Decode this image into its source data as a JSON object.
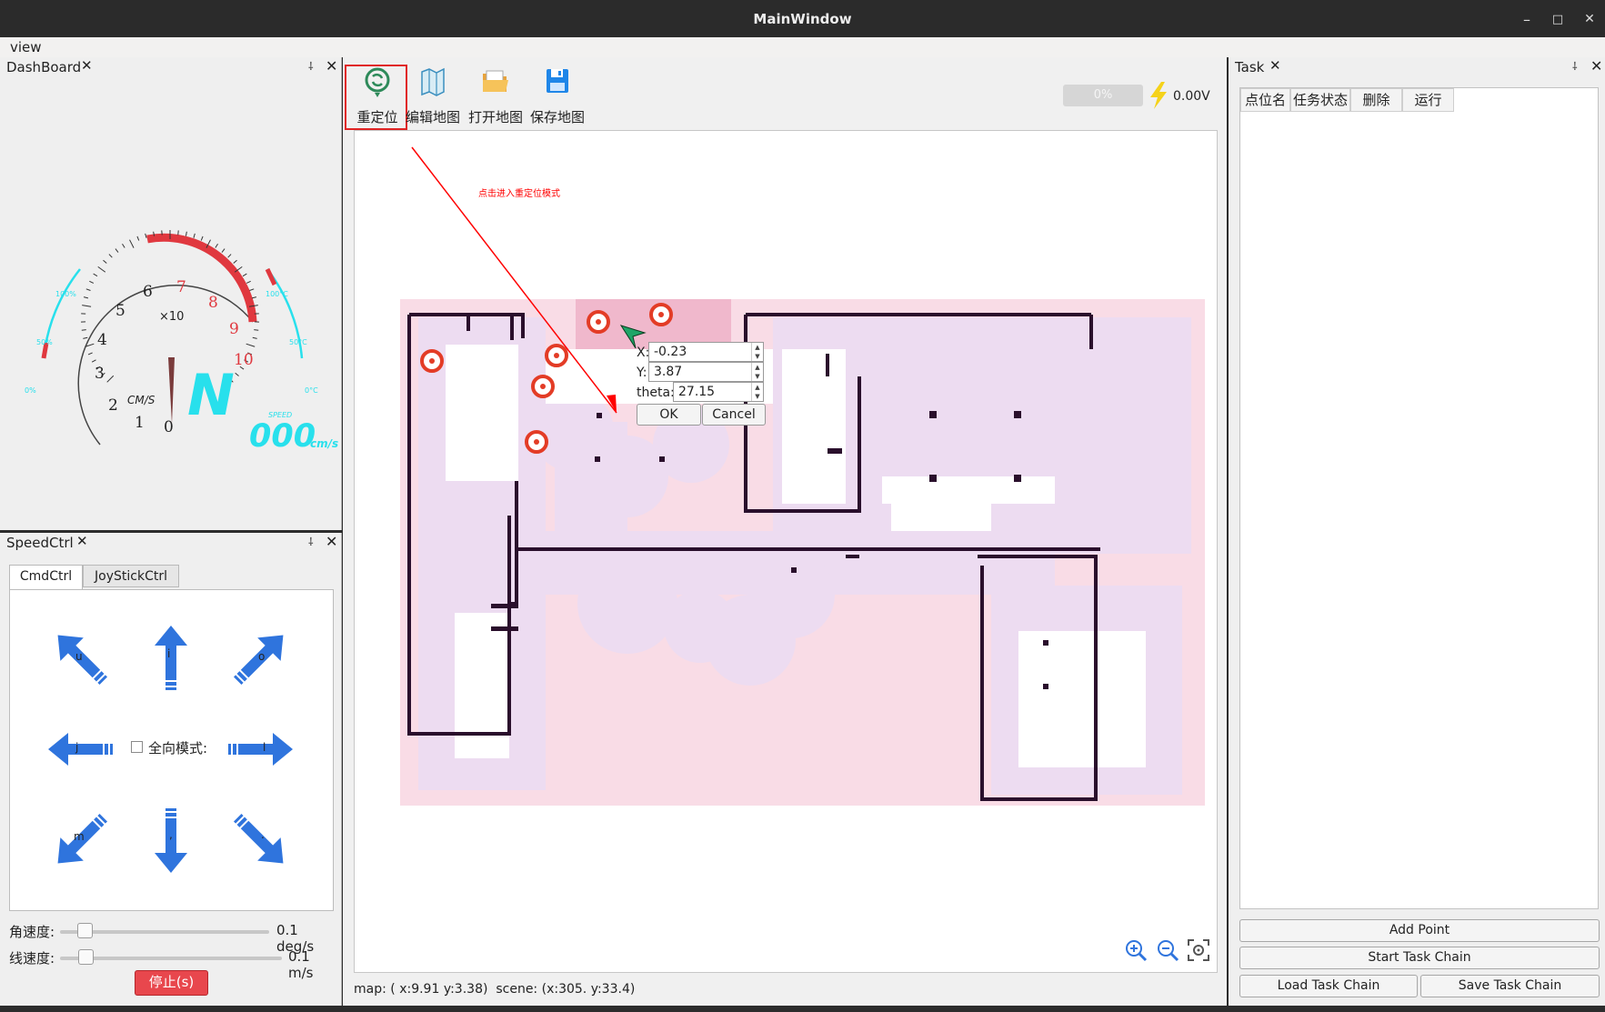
{
  "window": {
    "title": "MainWindow",
    "min": "–",
    "max": "□",
    "close": "✕"
  },
  "menubar": {
    "view": "view"
  },
  "dashboard": {
    "title": "DashBoard",
    "close": "✕",
    "gauge": {
      "ticks": [
        "0",
        "1",
        "2",
        "3",
        "4",
        "5",
        "6",
        "7",
        "8",
        "9",
        "10"
      ],
      "multiplier": "×10",
      "unit": "CM/S",
      "gear": "N",
      "speed_caption": "SPEED",
      "speed_value": "000",
      "speed_unit": "cm/s",
      "left_arc": [
        "100%",
        "50%",
        "0%"
      ],
      "right_arc": [
        "100°C",
        "50°C",
        "0°C"
      ]
    }
  },
  "speedctrl": {
    "title": "SpeedCtrl",
    "close": "✕",
    "tabs": [
      "CmdCtrl",
      "JoyStickCtrl"
    ],
    "keys": {
      "u": "u",
      "i": "i",
      "o": "o",
      "j": "j",
      "l": "l",
      "m": "m",
      "comma": ",",
      "dot": "."
    },
    "omni_label": "全向模式:",
    "angular": {
      "label": "角速度:",
      "value": "0.1 deg/s",
      "level": 0.1
    },
    "linear": {
      "label": "线速度:",
      "value": "0.1 m/s",
      "level": 0.1
    },
    "stop_label": "停止(s)"
  },
  "toolbar": {
    "relocate": "重定位",
    "edit_map": "编辑地图",
    "open_map": "打开地图",
    "save_map": "保存地图",
    "battery_percent": "0%",
    "battery_voltage": "0.00V"
  },
  "map": {
    "annotation": "点击进入重定位模式",
    "pose_dialog": {
      "x_label": "X:",
      "x_value": "-0.23",
      "y_label": "Y:",
      "y_value": "3.87",
      "theta_label": "theta:",
      "theta_value": "27.15",
      "ok": "OK",
      "cancel": "Cancel"
    },
    "status_map_label": "map:",
    "status_map_value": "( x:9.91 y:3.38)",
    "status_scene_label": "scene:",
    "status_scene_value": "(x:305. y:33.4)"
  },
  "task": {
    "title": "Task",
    "close": "✕",
    "columns": [
      "点位名",
      "任务状态",
      "删除",
      "运行"
    ],
    "add_point": "Add Point",
    "start_chain": "Start Task Chain",
    "load_chain": "Load Task Chain",
    "save_chain": "Save Task Chain"
  },
  "colors": {
    "accent": "#2f74dd",
    "stop": "#e8474d",
    "gauge_red": "#e0383f",
    "gauge_cyan": "#28e0ec"
  }
}
